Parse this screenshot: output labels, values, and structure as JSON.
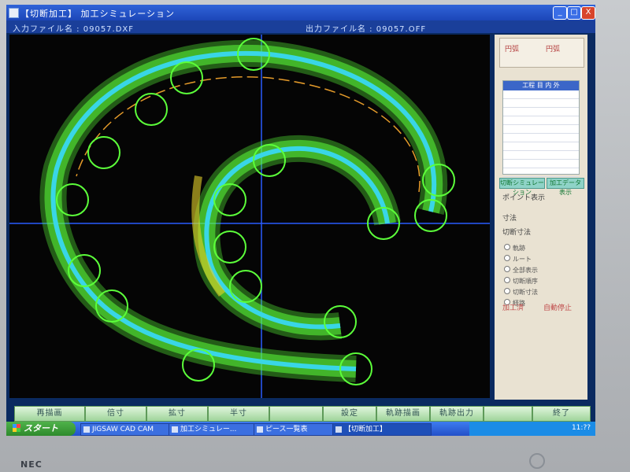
{
  "window": {
    "title": "【切断加工】 加工シミュレーション",
    "minimize": "_",
    "maximize": "□",
    "close": "X"
  },
  "filebar": {
    "input_file": "入力ファイル名 : 09057.DXF",
    "output_file": "出力ファイル名 : 09057.OFF"
  },
  "side_panel": {
    "options_top": [
      "円弧",
      "円弧"
    ],
    "table_header": "工程 目 内 外",
    "buttons": [
      "切断シミュレーション",
      "加工データ表示"
    ],
    "info_rows": [
      "ポイント表示",
      "寸法",
      "切断寸法"
    ],
    "radios": [
      "軌跡",
      "ルート",
      "全部表示",
      "切断順序",
      "切断寸法",
      "経路"
    ],
    "checks": [
      "加工済",
      "自動停止"
    ]
  },
  "bottom_buttons": [
    "再描画",
    "倍寸",
    "拡寸",
    "半寸",
    "",
    "設定",
    "軌跡描画",
    "軌跡出力",
    "",
    "終了"
  ],
  "taskbar": {
    "start_label": "スタート",
    "tasks": [
      "JIGSAW CAD CAM",
      "加工シミュレー...",
      "ピース一覧表",
      "【切断加工】"
    ],
    "clock": "11:??"
  },
  "monitor_brand": "NEC",
  "colors": {
    "path_green": "#5cff3a",
    "path_cyan": "#39d6e6",
    "path_orange": "#e59b2a",
    "axis_blue": "#2a5cff"
  }
}
